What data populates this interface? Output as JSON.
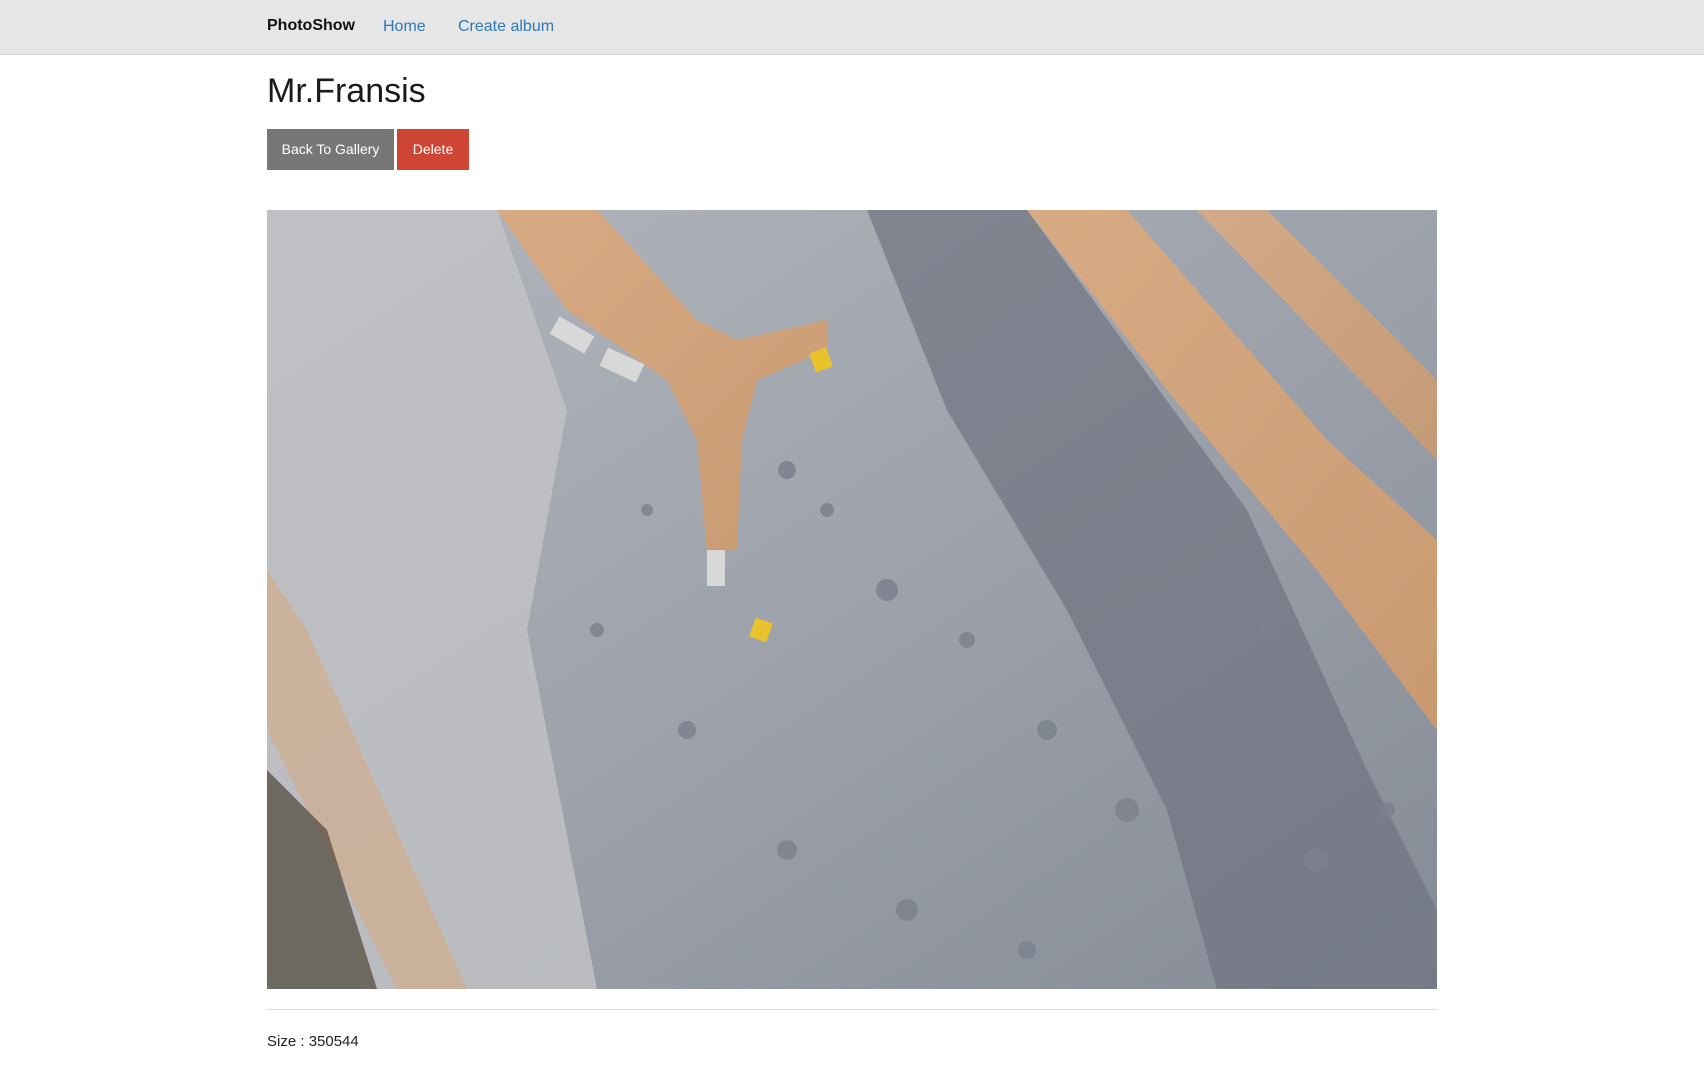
{
  "navbar": {
    "brand": "PhotoShow",
    "links": [
      "Home",
      "Create album"
    ]
  },
  "photo": {
    "title": "Mr.Fransis",
    "buttons": {
      "back": "Back To Gallery",
      "delete": "Delete"
    },
    "size_label": "Size :",
    "size_value": "350544",
    "image_subject": "aerial view of a quarry with excavators and dump trucks"
  },
  "colors": {
    "navbar_bg": "#e6e6e6",
    "link": "#2f78b5",
    "back_button": "#777777",
    "delete_button": "#cf4533"
  }
}
